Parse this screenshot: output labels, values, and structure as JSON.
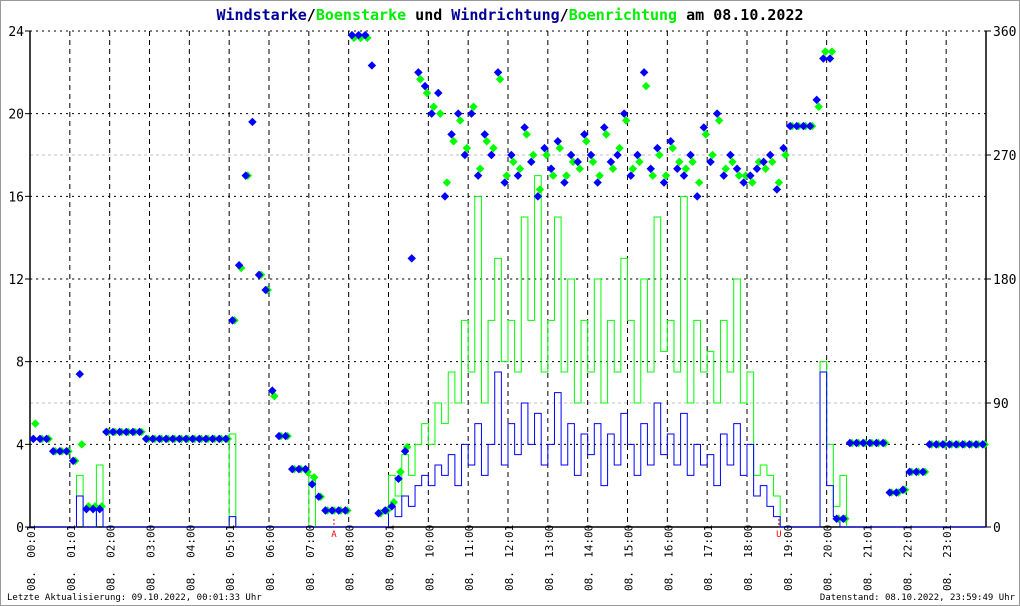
{
  "chart_data": {
    "type": "line",
    "title_parts": [
      {
        "text": "Windstarke",
        "color": "#000099"
      },
      {
        "text": "/",
        "color": "#000000"
      },
      {
        "text": "Boenstarke",
        "color": "#00ee00"
      },
      {
        "text": " und ",
        "color": "#000000"
      },
      {
        "text": "Windrichtung",
        "color": "#000099"
      },
      {
        "text": "/",
        "color": "#000000"
      },
      {
        "text": "Boenrichtung",
        "color": "#00ee00"
      },
      {
        "text": " am 08.10.2022",
        "color": "#000000"
      }
    ],
    "left_axis": {
      "range": [
        0,
        24
      ],
      "ticks": [
        "0",
        "4",
        "8",
        "12",
        "16",
        "20",
        "24"
      ]
    },
    "right_axis": {
      "range": [
        0,
        360
      ],
      "ticks": [
        "0",
        "90",
        "180",
        "270",
        "360"
      ]
    },
    "x_range_hours": [
      0,
      24
    ],
    "x_tick_labels": [
      "08. 00:01",
      "08. 01:01",
      "08. 02:00",
      "08. 03:00",
      "08. 04:00",
      "08. 05:01",
      "08. 06:00",
      "08. 07:00",
      "08. 08:00",
      "08. 09:01",
      "08. 10:00",
      "08. 11:00",
      "08. 12:01",
      "08. 13:00",
      "08. 14:00",
      "08. 15:00",
      "08. 16:00",
      "08. 17:01",
      "08. 18:00",
      "08. 19:00",
      "08. 20:00",
      "08. 21:01",
      "08. 22:01",
      "08. 23:01"
    ],
    "markers": [
      {
        "label": "A",
        "hour": 7.63,
        "color": "#ff0000"
      },
      {
        "label": "U",
        "hour": 18.8,
        "color": "#ff0000"
      }
    ],
    "sample_interval_minutes": 10,
    "colors": {
      "wind": "#0000ff",
      "gust": "#00ff00"
    },
    "series": [
      {
        "name": "Windstarke",
        "axis": "left",
        "kind": "line",
        "values": [
          0,
          0,
          0,
          0,
          0,
          0,
          0,
          1.5,
          0,
          0,
          1,
          0,
          0,
          0,
          0,
          0,
          0,
          0,
          0,
          0,
          0,
          0,
          0,
          0,
          0,
          0,
          0,
          0,
          0,
          0,
          0.5,
          0,
          0,
          0,
          0,
          0,
          0,
          0,
          0,
          0,
          0,
          0,
          0,
          0,
          0,
          0,
          0,
          0,
          0,
          0,
          0,
          0,
          0,
          0,
          1,
          0.5,
          1.5,
          1,
          2,
          2.5,
          2,
          3,
          2.5,
          3.5,
          2,
          4,
          3,
          5,
          2.5,
          4,
          7.5,
          3,
          5,
          3.5,
          6,
          4,
          5.5,
          3,
          4,
          6.5,
          3,
          5,
          2.5,
          4.5,
          3.5,
          5,
          2,
          4.5,
          3,
          5.5,
          4,
          2.5,
          5,
          3,
          6,
          3.5,
          4.5,
          3,
          5.5,
          2.5,
          4,
          3,
          3.5,
          2,
          4.5,
          3,
          5,
          2.5,
          4,
          1.5,
          2,
          1,
          0.5,
          0,
          0,
          0,
          0,
          0,
          0,
          7.5,
          2,
          0.5,
          0,
          0,
          0,
          0,
          0,
          0,
          0,
          0,
          0,
          0,
          0,
          0,
          0,
          0,
          0,
          0,
          0,
          0,
          0,
          0,
          0,
          0
        ]
      },
      {
        "name": "Boenstarke",
        "axis": "left",
        "kind": "line",
        "values": [
          0,
          0,
          0,
          0,
          0,
          0,
          0,
          2.5,
          0,
          0,
          3,
          0,
          0,
          0,
          0,
          0,
          0,
          0,
          0,
          0,
          0,
          0,
          0,
          0,
          0,
          0,
          0,
          0,
          0,
          0,
          4.5,
          0,
          0,
          0,
          0,
          0,
          0,
          0,
          0,
          0,
          0,
          0,
          2.5,
          0,
          0,
          0,
          0,
          0,
          0,
          0,
          0,
          0,
          0,
          0,
          2.5,
          1.5,
          3.5,
          2.5,
          4,
          5,
          4,
          6,
          5,
          7.5,
          6,
          10,
          7.5,
          16,
          6,
          10,
          13,
          8,
          10,
          7.5,
          15,
          10,
          17,
          7.5,
          10,
          15,
          7.5,
          12,
          6,
          10,
          7.5,
          12,
          6,
          10,
          7.5,
          13,
          10,
          6,
          12,
          7.5,
          15,
          8.5,
          10,
          7.5,
          16,
          6,
          10,
          7.5,
          8.5,
          6,
          10,
          7.5,
          12,
          6,
          7.5,
          2.5,
          3,
          2.5,
          1.5,
          0,
          0,
          0,
          0,
          0,
          0,
          8,
          4,
          1,
          2.5,
          0,
          0,
          0,
          0,
          0,
          0,
          0,
          0,
          0,
          0,
          0,
          0,
          0,
          0,
          0,
          0,
          0,
          0,
          0,
          0,
          0
        ]
      },
      {
        "name": "Windrichtung",
        "axis": "right",
        "kind": "scatter",
        "values": [
          64,
          64,
          64,
          55,
          55,
          55,
          48,
          111,
          13,
          13,
          13,
          69,
          69,
          69,
          69,
          69,
          69,
          64,
          64,
          64,
          64,
          64,
          64,
          64,
          64,
          64,
          64,
          64,
          64,
          64,
          150,
          190,
          255,
          294,
          183,
          172,
          99,
          66,
          66,
          42,
          42,
          42,
          31,
          22,
          12,
          12,
          12,
          12,
          357,
          357,
          357,
          335,
          10,
          12,
          15,
          35,
          55,
          195,
          330,
          320,
          300,
          315,
          240,
          285,
          300,
          270,
          300,
          255,
          285,
          270,
          330,
          250,
          270,
          255,
          290,
          265,
          240,
          275,
          260,
          280,
          250,
          270,
          265,
          285,
          270,
          250,
          290,
          265,
          270,
          300,
          255,
          270,
          330,
          260,
          275,
          250,
          280,
          260,
          255,
          270,
          240,
          290,
          265,
          300,
          255,
          270,
          260,
          250,
          255,
          260,
          265,
          270,
          245,
          275,
          291,
          291,
          291,
          291,
          310,
          340,
          340,
          6,
          6,
          61,
          61,
          61,
          61,
          61,
          61,
          25,
          25,
          27,
          40,
          40,
          40,
          60,
          60,
          60,
          60,
          60,
          60,
          60,
          60,
          60
        ]
      },
      {
        "name": "Boenrichtung",
        "axis": "right",
        "kind": "scatter",
        "values": [
          75,
          64,
          64,
          55,
          55,
          55,
          48,
          60,
          15,
          15,
          15,
          69,
          69,
          69,
          69,
          69,
          69,
          64,
          64,
          64,
          64,
          64,
          64,
          64,
          64,
          64,
          64,
          64,
          64,
          64,
          150,
          188,
          255,
          null,
          183,
          172,
          95,
          66,
          66,
          42,
          42,
          40,
          36,
          22,
          12,
          12,
          12,
          12,
          355,
          355,
          355,
          null,
          10,
          12,
          18,
          40,
          58,
          null,
          325,
          315,
          305,
          300,
          250,
          280,
          295,
          275,
          305,
          260,
          280,
          275,
          325,
          255,
          265,
          260,
          285,
          270,
          245,
          270,
          255,
          275,
          255,
          265,
          260,
          280,
          265,
          255,
          285,
          260,
          275,
          295,
          260,
          265,
          320,
          255,
          270,
          255,
          275,
          265,
          260,
          265,
          250,
          285,
          270,
          295,
          260,
          265,
          255,
          255,
          250,
          265,
          260,
          265,
          250,
          270,
          291,
          291,
          291,
          291,
          305,
          345,
          345,
          6,
          6,
          61,
          61,
          61,
          61,
          61,
          61,
          25,
          25,
          27,
          40,
          40,
          40,
          60,
          60,
          60,
          60,
          60,
          60,
          60,
          60,
          60
        ]
      }
    ]
  },
  "footer": {
    "last_update": "Letzte Aktualisierung: 09.10.2022, 00:01:33 Uhr",
    "data_state": "Datenstand: 08.10.2022, 23:59:49 Uhr"
  }
}
